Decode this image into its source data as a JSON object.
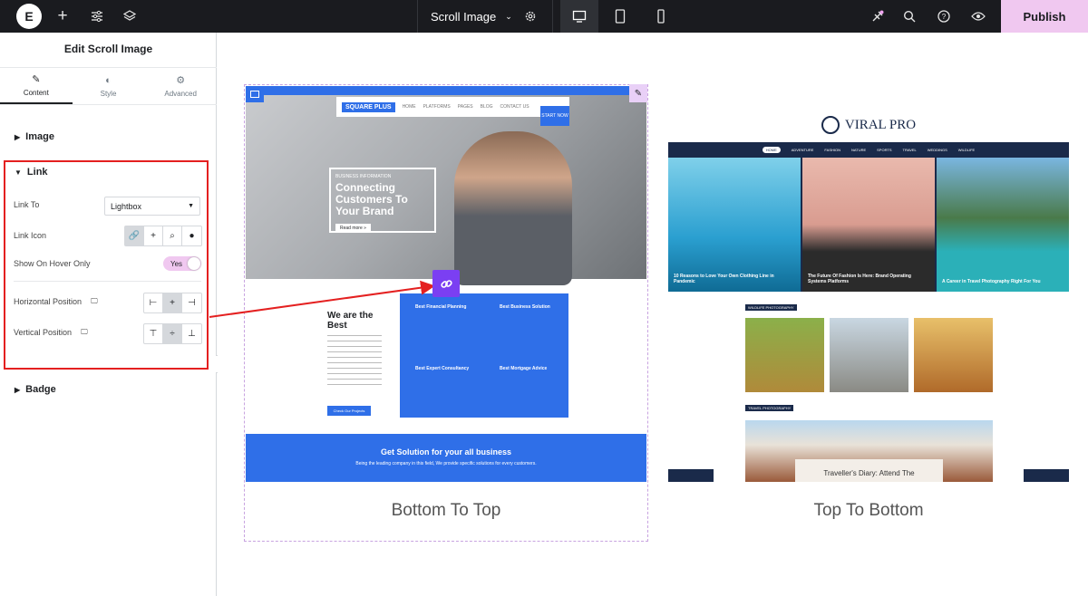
{
  "topbar": {
    "logo_letter": "E",
    "document_title": "Scroll Image",
    "publish_label": "Publish",
    "icons": [
      "plus-icon",
      "sliders-icon",
      "layers-icon",
      "gear-icon",
      "desktop-icon",
      "tablet-icon",
      "mobile-icon",
      "notifications-icon",
      "search-icon",
      "help-icon",
      "preview-eye-icon"
    ]
  },
  "panel": {
    "title": "Edit Scroll Image",
    "tabs": [
      {
        "label": "Content",
        "icon": "pencil-icon"
      },
      {
        "label": "Style",
        "icon": "contrast-icon"
      },
      {
        "label": "Advanced",
        "icon": "gear-icon"
      }
    ],
    "sections": {
      "image": "Image",
      "link": "Link",
      "badge": "Badge"
    },
    "link_to_label": "Link To",
    "link_to_value": "Lightbox",
    "link_icon_label": "Link Icon",
    "show_on_hover_label": "Show On Hover Only",
    "show_on_hover_value": "Yes",
    "horizontal_position_label": "Horizontal Position",
    "vertical_position_label": "Vertical Position"
  },
  "preview1": {
    "brand": "SQUARE PLUS",
    "nav": [
      "HOME",
      "PLATFORMS",
      "PAGES",
      "BLOG",
      "CONTACT US"
    ],
    "cta": "START NOW",
    "hero_kicker": "BUSINESS INFORMATION",
    "hero_title": "Connecting Customers To Your Brand",
    "hero_btn": "Read more »",
    "about_title": "We are the Best",
    "about_btn": "Check Our Projects",
    "services": [
      "Best Financial Planning",
      "Best Business Solution",
      "Best Expert Consultancy",
      "Best Mortgage Advice"
    ],
    "banner_title": "Get Solution for your all business",
    "banner_sub": "Being the leading company in this field, We provide specific solutions for every customers.",
    "caption": "Bottom To Top"
  },
  "preview2": {
    "brand": "VIRAL PRO",
    "nav": [
      "HOME",
      "ADVENTURE",
      "FASHION",
      "NATURE",
      "SPORTS",
      "TRAVEL",
      "WEDDINGS",
      "WILDLIFE"
    ],
    "post1": "10 Reasons to Love Your Own Clothing Line in Pandemic",
    "post2": "The Future Of Fashion Is Here: Brand Operating Systems Platforms",
    "post3": "A Career in Travel Photography Right For You",
    "sec1": "WILDLIFE PHOTOGRAPHY",
    "sec2": "TRAVEL PHOTOGRAPHY",
    "feature": "Traveller's Diary: Attend The",
    "caption": "Top To Bottom"
  }
}
